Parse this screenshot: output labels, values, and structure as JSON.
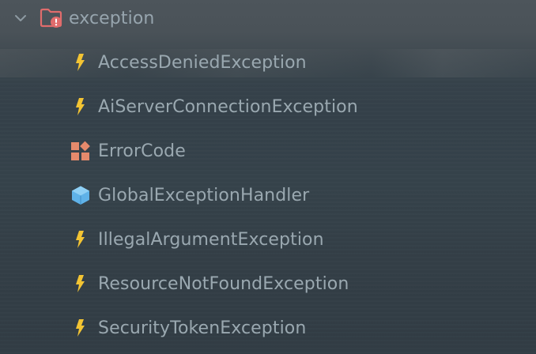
{
  "folder": {
    "name": "exception",
    "expanded": true,
    "icon": "folder-error-icon",
    "icon_color": "#e06c6c"
  },
  "items": [
    {
      "label": "AccessDeniedException",
      "icon": "lightning-bolt-icon",
      "icon_color": "#f3c433"
    },
    {
      "label": "AiServerConnectionException",
      "icon": "lightning-bolt-icon",
      "icon_color": "#f3c433"
    },
    {
      "label": "ErrorCode",
      "icon": "enum-icon",
      "icon_color": "#e58a6c"
    },
    {
      "label": "GlobalExceptionHandler",
      "icon": "class-cube-icon",
      "icon_color": "#5fb2e8"
    },
    {
      "label": "IllegalArgumentException",
      "icon": "lightning-bolt-icon",
      "icon_color": "#f3c433"
    },
    {
      "label": "ResourceNotFoundException",
      "icon": "lightning-bolt-icon",
      "icon_color": "#f3c433"
    },
    {
      "label": "SecurityTokenException",
      "icon": "lightning-bolt-icon",
      "icon_color": "#f3c433"
    }
  ],
  "colors": {
    "text": "#9aa8b0",
    "background": "#3a454d"
  }
}
